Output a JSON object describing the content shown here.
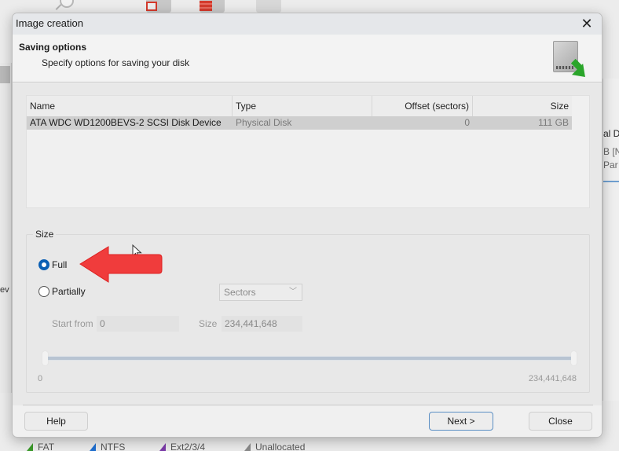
{
  "background": {
    "right_panel_texts": [
      "al D",
      "B [N",
      "Par"
    ],
    "left_panel_text": "ev",
    "legend": [
      {
        "label": "FAT",
        "color": "#3b9a2a"
      },
      {
        "label": "NTFS",
        "color": "#1f6fd0"
      },
      {
        "label": "Ext2/3/4",
        "color": "#7b3aa8"
      },
      {
        "label": "Unallocated",
        "color": "#8a8a8a"
      }
    ]
  },
  "dialog": {
    "title": "Image creation",
    "close_icon": "close-icon",
    "header": {
      "title": "Saving options",
      "subtitle": "Specify options for saving your disk",
      "icon": "disk-save-icon"
    },
    "table": {
      "columns": [
        "Name",
        "Type",
        "Offset (sectors)",
        "Size"
      ],
      "rows": [
        {
          "name": "ATA WDC WD1200BEVS-2 SCSI Disk Device",
          "type": "Physical Disk",
          "offset": "0",
          "size": "111 GB"
        }
      ]
    },
    "size_group": {
      "label": "Size",
      "options": [
        {
          "label": "Full",
          "checked": true
        },
        {
          "label": "Partially",
          "checked": false
        }
      ],
      "unit_select": {
        "value": "Sectors"
      },
      "start_from": {
        "label": "Start from",
        "value": "0"
      },
      "size_field": {
        "label": "Size",
        "value": "234,441,648"
      },
      "range": {
        "min_label": "0",
        "max_label": "234,441,648",
        "start_fraction": 0.0,
        "end_fraction": 1.0
      }
    },
    "annotation": {
      "type": "red-arrow",
      "points_to": "Full",
      "color": "#f03c3c"
    },
    "buttons": {
      "help": "Help",
      "next": "Next >",
      "close": "Close"
    }
  }
}
